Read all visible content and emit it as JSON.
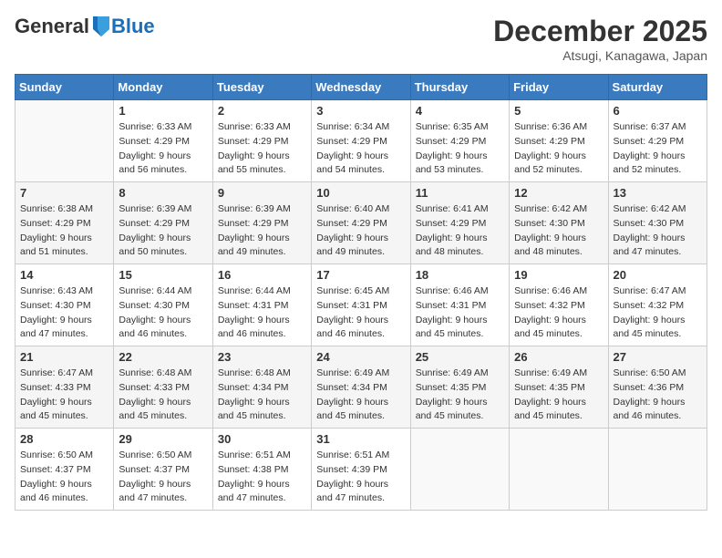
{
  "logo": {
    "general": "General",
    "blue": "Blue"
  },
  "header": {
    "month": "December 2025",
    "location": "Atsugi, Kanagawa, Japan"
  },
  "weekdays": [
    "Sunday",
    "Monday",
    "Tuesday",
    "Wednesday",
    "Thursday",
    "Friday",
    "Saturday"
  ],
  "weeks": [
    [
      {
        "day": "",
        "sunrise": "",
        "sunset": "",
        "daylight": ""
      },
      {
        "day": "1",
        "sunrise": "Sunrise: 6:33 AM",
        "sunset": "Sunset: 4:29 PM",
        "daylight": "Daylight: 9 hours and 56 minutes."
      },
      {
        "day": "2",
        "sunrise": "Sunrise: 6:33 AM",
        "sunset": "Sunset: 4:29 PM",
        "daylight": "Daylight: 9 hours and 55 minutes."
      },
      {
        "day": "3",
        "sunrise": "Sunrise: 6:34 AM",
        "sunset": "Sunset: 4:29 PM",
        "daylight": "Daylight: 9 hours and 54 minutes."
      },
      {
        "day": "4",
        "sunrise": "Sunrise: 6:35 AM",
        "sunset": "Sunset: 4:29 PM",
        "daylight": "Daylight: 9 hours and 53 minutes."
      },
      {
        "day": "5",
        "sunrise": "Sunrise: 6:36 AM",
        "sunset": "Sunset: 4:29 PM",
        "daylight": "Daylight: 9 hours and 52 minutes."
      },
      {
        "day": "6",
        "sunrise": "Sunrise: 6:37 AM",
        "sunset": "Sunset: 4:29 PM",
        "daylight": "Daylight: 9 hours and 52 minutes."
      }
    ],
    [
      {
        "day": "7",
        "sunrise": "Sunrise: 6:38 AM",
        "sunset": "Sunset: 4:29 PM",
        "daylight": "Daylight: 9 hours and 51 minutes."
      },
      {
        "day": "8",
        "sunrise": "Sunrise: 6:39 AM",
        "sunset": "Sunset: 4:29 PM",
        "daylight": "Daylight: 9 hours and 50 minutes."
      },
      {
        "day": "9",
        "sunrise": "Sunrise: 6:39 AM",
        "sunset": "Sunset: 4:29 PM",
        "daylight": "Daylight: 9 hours and 49 minutes."
      },
      {
        "day": "10",
        "sunrise": "Sunrise: 6:40 AM",
        "sunset": "Sunset: 4:29 PM",
        "daylight": "Daylight: 9 hours and 49 minutes."
      },
      {
        "day": "11",
        "sunrise": "Sunrise: 6:41 AM",
        "sunset": "Sunset: 4:29 PM",
        "daylight": "Daylight: 9 hours and 48 minutes."
      },
      {
        "day": "12",
        "sunrise": "Sunrise: 6:42 AM",
        "sunset": "Sunset: 4:30 PM",
        "daylight": "Daylight: 9 hours and 48 minutes."
      },
      {
        "day": "13",
        "sunrise": "Sunrise: 6:42 AM",
        "sunset": "Sunset: 4:30 PM",
        "daylight": "Daylight: 9 hours and 47 minutes."
      }
    ],
    [
      {
        "day": "14",
        "sunrise": "Sunrise: 6:43 AM",
        "sunset": "Sunset: 4:30 PM",
        "daylight": "Daylight: 9 hours and 47 minutes."
      },
      {
        "day": "15",
        "sunrise": "Sunrise: 6:44 AM",
        "sunset": "Sunset: 4:30 PM",
        "daylight": "Daylight: 9 hours and 46 minutes."
      },
      {
        "day": "16",
        "sunrise": "Sunrise: 6:44 AM",
        "sunset": "Sunset: 4:31 PM",
        "daylight": "Daylight: 9 hours and 46 minutes."
      },
      {
        "day": "17",
        "sunrise": "Sunrise: 6:45 AM",
        "sunset": "Sunset: 4:31 PM",
        "daylight": "Daylight: 9 hours and 46 minutes."
      },
      {
        "day": "18",
        "sunrise": "Sunrise: 6:46 AM",
        "sunset": "Sunset: 4:31 PM",
        "daylight": "Daylight: 9 hours and 45 minutes."
      },
      {
        "day": "19",
        "sunrise": "Sunrise: 6:46 AM",
        "sunset": "Sunset: 4:32 PM",
        "daylight": "Daylight: 9 hours and 45 minutes."
      },
      {
        "day": "20",
        "sunrise": "Sunrise: 6:47 AM",
        "sunset": "Sunset: 4:32 PM",
        "daylight": "Daylight: 9 hours and 45 minutes."
      }
    ],
    [
      {
        "day": "21",
        "sunrise": "Sunrise: 6:47 AM",
        "sunset": "Sunset: 4:33 PM",
        "daylight": "Daylight: 9 hours and 45 minutes."
      },
      {
        "day": "22",
        "sunrise": "Sunrise: 6:48 AM",
        "sunset": "Sunset: 4:33 PM",
        "daylight": "Daylight: 9 hours and 45 minutes."
      },
      {
        "day": "23",
        "sunrise": "Sunrise: 6:48 AM",
        "sunset": "Sunset: 4:34 PM",
        "daylight": "Daylight: 9 hours and 45 minutes."
      },
      {
        "day": "24",
        "sunrise": "Sunrise: 6:49 AM",
        "sunset": "Sunset: 4:34 PM",
        "daylight": "Daylight: 9 hours and 45 minutes."
      },
      {
        "day": "25",
        "sunrise": "Sunrise: 6:49 AM",
        "sunset": "Sunset: 4:35 PM",
        "daylight": "Daylight: 9 hours and 45 minutes."
      },
      {
        "day": "26",
        "sunrise": "Sunrise: 6:49 AM",
        "sunset": "Sunset: 4:35 PM",
        "daylight": "Daylight: 9 hours and 45 minutes."
      },
      {
        "day": "27",
        "sunrise": "Sunrise: 6:50 AM",
        "sunset": "Sunset: 4:36 PM",
        "daylight": "Daylight: 9 hours and 46 minutes."
      }
    ],
    [
      {
        "day": "28",
        "sunrise": "Sunrise: 6:50 AM",
        "sunset": "Sunset: 4:37 PM",
        "daylight": "Daylight: 9 hours and 46 minutes."
      },
      {
        "day": "29",
        "sunrise": "Sunrise: 6:50 AM",
        "sunset": "Sunset: 4:37 PM",
        "daylight": "Daylight: 9 hours and 47 minutes."
      },
      {
        "day": "30",
        "sunrise": "Sunrise: 6:51 AM",
        "sunset": "Sunset: 4:38 PM",
        "daylight": "Daylight: 9 hours and 47 minutes."
      },
      {
        "day": "31",
        "sunrise": "Sunrise: 6:51 AM",
        "sunset": "Sunset: 4:39 PM",
        "daylight": "Daylight: 9 hours and 47 minutes."
      },
      {
        "day": "",
        "sunrise": "",
        "sunset": "",
        "daylight": ""
      },
      {
        "day": "",
        "sunrise": "",
        "sunset": "",
        "daylight": ""
      },
      {
        "day": "",
        "sunrise": "",
        "sunset": "",
        "daylight": ""
      }
    ]
  ]
}
